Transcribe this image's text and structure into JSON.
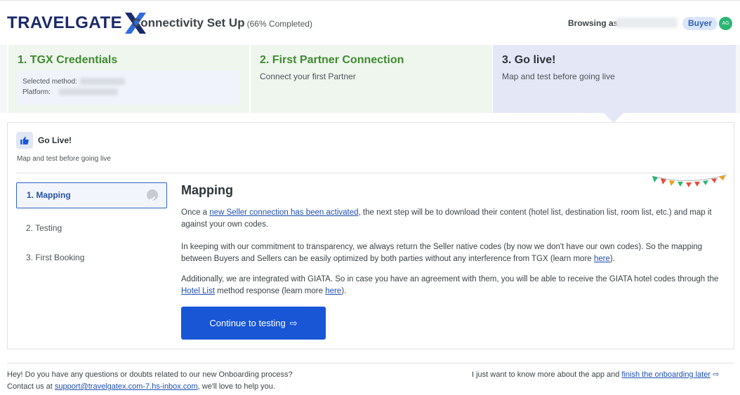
{
  "header": {
    "logo_text": "TRAVELGATE",
    "logo_mark": "X",
    "title": "Connectivity Set Up",
    "progress": "(66% Completed)",
    "browsing_label": "Browsing as:",
    "role_badge": "Buyer",
    "avatar_initials": "AG"
  },
  "steps": [
    {
      "title": "1. TGX Credentials",
      "method_label": "Selected method:",
      "platform_label": "Platform:"
    },
    {
      "title": "2. First Partner Connection",
      "subtitle": "Connect your first Partner"
    },
    {
      "title": "3. Go live!",
      "subtitle": "Map and test before going live"
    }
  ],
  "card": {
    "icon": "thumbs-up-icon",
    "title": "Go Live!",
    "subtitle": "Map and test before going live",
    "substeps": [
      {
        "label": "1. Mapping",
        "active": true
      },
      {
        "label": "2. Testing",
        "active": false
      },
      {
        "label": "3. First Booking",
        "active": false
      }
    ],
    "content": {
      "title": "Mapping",
      "p1_before": "Once a ",
      "p1_link": "new Seller connection has been activated",
      "p1_after": ", the next step will be to download their content (hotel list, destination list, room list, etc.) and map it against your own codes.",
      "p2_before": "In keeping with our commitment to transparency, we always return the Seller native codes (by now we don't have our own codes). So the mapping between Buyers and Sellers can be easily optimized by both parties without any interference from TGX (learn more ",
      "p2_link": "here",
      "p2_after": ").",
      "p3_before": "Additionally, we are integrated with GIATA. So in case you have an agreement with them, you will be able to receive the GIATA hotel codes through the ",
      "p3_link1": "Hotel List",
      "p3_middle": " method response (learn more ",
      "p3_link2": "here",
      "p3_after": ").",
      "cta_label": "Continue to testing",
      "cta_arrow": "⇨"
    }
  },
  "footer": {
    "left_line1": "Hey! Do you have any questions or doubts related to our new Onboarding process?",
    "left_line2_before": "Contact us at ",
    "left_email": "support@travelgatex.com-7.hs-inbox.com",
    "left_line2_after": ", we'll love to help you.",
    "right_before": "I just want to know more about the app and ",
    "right_link": "finish the onboarding later",
    "right_arrow": "⇨"
  },
  "colors": {
    "brand_navy": "#1b2a6b",
    "brand_blue": "#1856d6",
    "completed_green": "#3f8a2f",
    "completed_bg": "#eef6ee",
    "current_bg": "#e3e7f6"
  }
}
